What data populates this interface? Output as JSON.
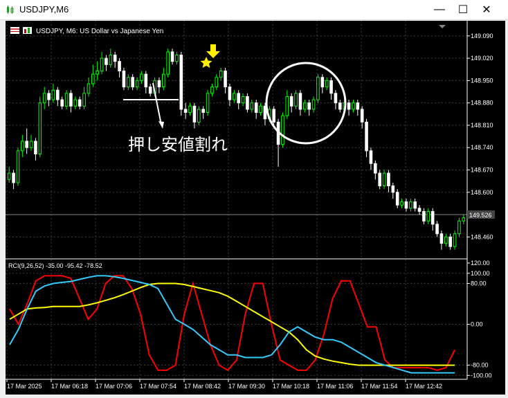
{
  "window": {
    "title": "USDJPY,M6",
    "minimize_glyph": "—",
    "maximize_glyph": "☐",
    "close_glyph": "✕"
  },
  "header": {
    "symbol_text": "USDJPY, M6:  US Dollar vs Japanese Yen"
  },
  "annotations": {
    "annotation_text": "押し安値割れ"
  },
  "price_panel": {
    "current_price": "149.526",
    "ticks": [
      "149.090",
      "149.020",
      "148.950",
      "148.880",
      "148.810",
      "148.740",
      "148.670",
      "148.600",
      "148.460"
    ]
  },
  "rci_panel": {
    "label": "RCI(9,26,52) -35.00 -95.42 -78.52",
    "ticks": [
      "120.00",
      "100.00",
      "80.00",
      "0.00",
      "-80.00",
      "-100.00"
    ]
  },
  "x_axis": {
    "ticks": [
      "17 Mar 2025",
      "17 Mar 06:18",
      "17 Mar 07:06",
      "17 Mar 07:54",
      "17 Mar 08:42",
      "17 Mar 09:30",
      "17 Mar 10:18",
      "17 Mar 11:06",
      "17 Mar 11:54",
      "17 Mar 12:42"
    ]
  },
  "colors": {
    "background": "#000000",
    "bull": "#00ff00",
    "bear": "#ffffff",
    "grid": "#3c3c3c",
    "rci_short": "#ff0000",
    "rci_mid": "#ffff00",
    "rci_long": "#33ccff",
    "arrow": "#ffee00"
  },
  "chart_data": [
    {
      "type": "candlestick",
      "title": "USDJPY, M6:  US Dollar vs Japanese Yen",
      "ylim": [
        148.4,
        149.12
      ],
      "y_ticks": [
        149.09,
        149.02,
        148.95,
        148.88,
        148.81,
        148.74,
        148.67,
        148.6,
        148.46
      ],
      "current_price": 149.526,
      "candles": [
        [
          148.64,
          148.66,
          148.63,
          148.68
        ],
        [
          148.66,
          148.63,
          148.61,
          148.67
        ],
        [
          148.63,
          148.73,
          148.62,
          148.74
        ],
        [
          148.73,
          148.76,
          148.71,
          148.78
        ],
        [
          148.76,
          148.74,
          148.72,
          148.8
        ],
        [
          148.74,
          148.76,
          148.73,
          148.78
        ],
        [
          148.76,
          148.72,
          148.7,
          148.77
        ],
        [
          148.72,
          148.88,
          148.71,
          148.9
        ],
        [
          148.88,
          148.91,
          148.86,
          148.93
        ],
        [
          148.91,
          148.89,
          148.87,
          148.92
        ],
        [
          148.89,
          148.92,
          148.88,
          148.94
        ],
        [
          148.92,
          148.89,
          148.87,
          148.93
        ],
        [
          148.89,
          148.87,
          148.86,
          148.9
        ],
        [
          148.87,
          148.91,
          148.86,
          148.92
        ],
        [
          148.91,
          148.87,
          148.85,
          148.92
        ],
        [
          148.87,
          148.89,
          148.86,
          148.9
        ],
        [
          148.89,
          148.87,
          148.86,
          148.9
        ],
        [
          148.87,
          148.91,
          148.86,
          148.93
        ],
        [
          148.91,
          148.94,
          148.9,
          148.96
        ],
        [
          148.94,
          148.97,
          148.93,
          149.0
        ],
        [
          148.97,
          148.98,
          148.95,
          149.01
        ],
        [
          148.98,
          149.02,
          148.97,
          149.04
        ],
        [
          149.02,
          149.0,
          148.98,
          149.03
        ],
        [
          149.0,
          149.03,
          148.99,
          149.05
        ],
        [
          149.03,
          149.01,
          148.99,
          149.04
        ],
        [
          149.01,
          148.98,
          148.96,
          149.02
        ],
        [
          148.98,
          148.93,
          148.92,
          148.99
        ],
        [
          148.93,
          148.96,
          148.92,
          148.97
        ],
        [
          148.96,
          148.93,
          148.92,
          148.97
        ],
        [
          148.93,
          148.95,
          148.92,
          148.96
        ],
        [
          148.95,
          148.97,
          148.94,
          148.98
        ],
        [
          148.97,
          148.93,
          148.91,
          148.98
        ],
        [
          148.93,
          148.91,
          148.9,
          148.94
        ],
        [
          148.91,
          148.95,
          148.9,
          148.96
        ],
        [
          148.95,
          148.93,
          148.91,
          148.96
        ],
        [
          148.93,
          148.97,
          148.92,
          148.99
        ],
        [
          148.97,
          149.04,
          148.96,
          149.05
        ],
        [
          149.04,
          149.01,
          149.0,
          149.05
        ],
        [
          149.01,
          149.03,
          149.0,
          149.04
        ],
        [
          149.03,
          148.86,
          148.84,
          149.04
        ],
        [
          148.86,
          148.85,
          148.83,
          148.88
        ],
        [
          148.85,
          148.87,
          148.84,
          148.88
        ],
        [
          148.87,
          148.82,
          148.8,
          148.88
        ],
        [
          148.82,
          148.86,
          148.81,
          148.87
        ],
        [
          148.86,
          148.85,
          148.83,
          148.87
        ],
        [
          148.85,
          148.91,
          148.84,
          148.92
        ],
        [
          148.91,
          148.93,
          148.9,
          148.94
        ],
        [
          148.93,
          148.96,
          148.92,
          148.97
        ],
        [
          148.96,
          148.98,
          148.95,
          148.99
        ],
        [
          148.98,
          148.93,
          148.91,
          148.99
        ],
        [
          148.93,
          148.89,
          148.87,
          148.94
        ],
        [
          148.89,
          148.91,
          148.88,
          148.92
        ],
        [
          148.91,
          148.88,
          148.86,
          148.92
        ],
        [
          148.88,
          148.9,
          148.87,
          148.91
        ],
        [
          148.9,
          148.86,
          148.85,
          148.91
        ],
        [
          148.86,
          148.88,
          148.85,
          148.89
        ],
        [
          148.88,
          148.85,
          148.83,
          148.89
        ],
        [
          148.85,
          148.87,
          148.84,
          148.88
        ],
        [
          148.87,
          148.83,
          148.81,
          148.88
        ],
        [
          148.83,
          148.86,
          148.82,
          148.87
        ],
        [
          148.86,
          148.82,
          148.8,
          148.87
        ],
        [
          148.82,
          148.75,
          148.68,
          148.83
        ],
        [
          148.75,
          148.84,
          148.74,
          148.85
        ],
        [
          148.84,
          148.9,
          148.83,
          148.92
        ],
        [
          148.9,
          148.87,
          148.85,
          148.91
        ],
        [
          148.87,
          148.91,
          148.86,
          148.92
        ],
        [
          148.91,
          148.86,
          148.84,
          148.92
        ],
        [
          148.86,
          148.88,
          148.85,
          148.89
        ],
        [
          148.88,
          148.86,
          148.84,
          148.89
        ],
        [
          148.86,
          148.89,
          148.85,
          148.9
        ],
        [
          148.89,
          148.96,
          148.88,
          148.97
        ],
        [
          148.96,
          148.93,
          148.91,
          148.97
        ],
        [
          148.93,
          148.95,
          148.92,
          148.96
        ],
        [
          148.95,
          148.91,
          148.89,
          148.96
        ],
        [
          148.91,
          148.88,
          148.86,
          148.92
        ],
        [
          148.88,
          148.86,
          148.85,
          148.89
        ],
        [
          148.86,
          148.88,
          148.85,
          148.89
        ],
        [
          148.88,
          148.86,
          148.84,
          148.89
        ],
        [
          148.86,
          148.88,
          148.85,
          148.89
        ],
        [
          148.88,
          148.86,
          148.84,
          148.89
        ],
        [
          148.86,
          148.82,
          148.8,
          148.87
        ],
        [
          148.82,
          148.73,
          148.71,
          148.83
        ],
        [
          148.73,
          148.69,
          148.67,
          148.74
        ],
        [
          148.69,
          148.66,
          148.64,
          148.7
        ],
        [
          148.66,
          148.62,
          148.61,
          148.67
        ],
        [
          148.62,
          148.66,
          148.61,
          148.67
        ],
        [
          148.66,
          148.62,
          148.6,
          148.67
        ],
        [
          148.62,
          148.6,
          148.58,
          148.63
        ],
        [
          148.6,
          148.56,
          148.55,
          148.61
        ],
        [
          148.56,
          148.57,
          148.55,
          148.58
        ],
        [
          148.57,
          148.55,
          148.54,
          148.58
        ],
        [
          148.55,
          148.57,
          148.54,
          148.58
        ],
        [
          148.57,
          148.55,
          148.54,
          148.58
        ],
        [
          148.55,
          148.54,
          148.53,
          148.56
        ],
        [
          148.54,
          148.51,
          148.5,
          148.55
        ],
        [
          148.51,
          148.54,
          148.5,
          148.55
        ],
        [
          148.54,
          148.5,
          148.48,
          148.55
        ],
        [
          148.5,
          148.47,
          148.46,
          148.51
        ],
        [
          148.47,
          148.44,
          148.42,
          148.48
        ],
        [
          148.44,
          148.46,
          148.43,
          148.47
        ],
        [
          148.46,
          148.43,
          148.42,
          148.47
        ],
        [
          148.43,
          148.47,
          148.42,
          148.48
        ],
        [
          148.47,
          148.51,
          148.46,
          148.52
        ],
        [
          148.51,
          148.52,
          148.5,
          148.53
        ]
      ]
    },
    {
      "type": "line",
      "title": "RCI(9,26,52) -35.00 -95.42 -78.52",
      "ylim": [
        -105,
        120
      ],
      "y_ticks": [
        120,
        100,
        80,
        0,
        -80,
        -100
      ],
      "series": [
        {
          "color": "#ff0000",
          "values": [
            30,
            0,
            40,
            85,
            95,
            95,
            95,
            90,
            50,
            10,
            30,
            80,
            95,
            95,
            70,
            20,
            -60,
            -90,
            -90,
            -80,
            20,
            80,
            20,
            -40,
            -80,
            -90,
            -70,
            20,
            80,
            80,
            0,
            -70,
            -80,
            -90,
            -90,
            -70,
            -20,
            50,
            85,
            85,
            40,
            -5,
            -5,
            -70,
            -85,
            -85,
            -85,
            -85,
            -85,
            -90,
            -85,
            -50
          ]
        },
        {
          "color": "#ffff00",
          "values": [
            10,
            20,
            30,
            32,
            33,
            35,
            35,
            35,
            35,
            38,
            42,
            47,
            52,
            58,
            65,
            72,
            78,
            80,
            80,
            80,
            78,
            74,
            70,
            66,
            62,
            55,
            45,
            35,
            25,
            15,
            5,
            -5,
            -15,
            -30,
            -50,
            -62,
            -68,
            -72,
            -75,
            -78,
            -80,
            -80,
            -80,
            -80,
            -80,
            -80,
            -80,
            -80,
            -80,
            -80,
            -80,
            -80
          ]
        },
        {
          "color": "#33ccff",
          "values": [
            -40,
            -10,
            30,
            65,
            75,
            80,
            82,
            84,
            88,
            92,
            95,
            95,
            93,
            90,
            86,
            82,
            78,
            70,
            40,
            10,
            0,
            -10,
            -25,
            -40,
            -50,
            -60,
            -60,
            -65,
            -65,
            -65,
            -60,
            -40,
            -15,
            -5,
            -15,
            -25,
            -30,
            -30,
            -35,
            -45,
            -55,
            -65,
            -75,
            -80,
            -85,
            -90,
            -95,
            -95,
            -95,
            -95,
            -95,
            -95
          ]
        }
      ]
    }
  ]
}
